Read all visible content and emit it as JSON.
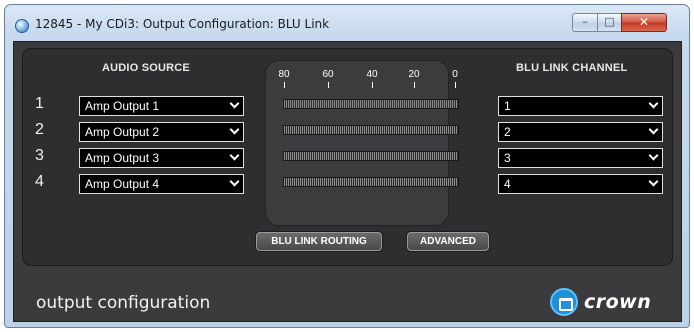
{
  "window": {
    "title": "12845 - My CDi3: Output Configuration: BLU Link",
    "controls": {
      "minimize": "–",
      "maximize": "□",
      "close": "✕"
    }
  },
  "audio_source": {
    "header": "AUDIO SOURCE",
    "rows": [
      {
        "number": "1",
        "value": "Amp Output 1"
      },
      {
        "number": "2",
        "value": "Amp Output 2"
      },
      {
        "number": "3",
        "value": "Amp Output 3"
      },
      {
        "number": "4",
        "value": "Amp Output 4"
      }
    ]
  },
  "meter": {
    "scale": [
      "80",
      "60",
      "40",
      "20",
      "0"
    ]
  },
  "blu_link_channel": {
    "header": "BLU LINK CHANNEL",
    "rows": [
      {
        "value": "1"
      },
      {
        "value": "2"
      },
      {
        "value": "3"
      },
      {
        "value": "4"
      }
    ]
  },
  "buttons": {
    "routing": "BLU LINK ROUTING",
    "advanced": "ADVANCED"
  },
  "footer": {
    "section_title": "output configuration",
    "brand": "crown"
  },
  "icons": {
    "app": "app-globe-icon",
    "brand": "crown-logo-icon",
    "dropdown": "chevron-down-icon"
  },
  "colors": {
    "panel": "#2e2e30",
    "background": "#3b3b3d",
    "brand_blue": "#1f8fd6"
  }
}
